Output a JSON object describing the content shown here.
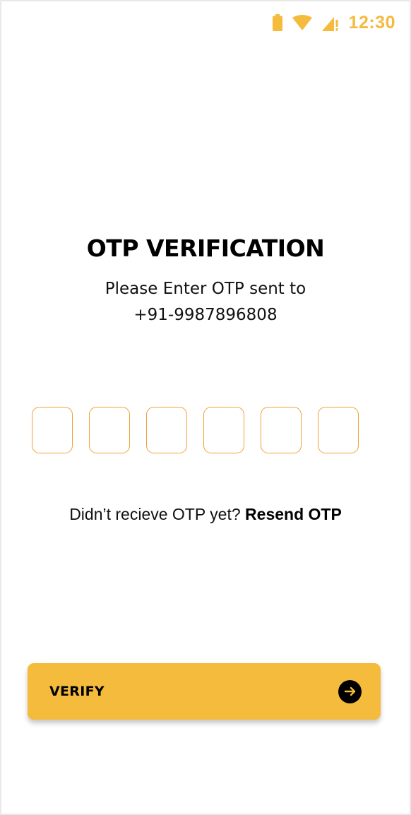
{
  "status_bar": {
    "time": "12:30",
    "icons": [
      "battery-icon",
      "wifi-icon",
      "cell-signal-icon"
    ],
    "accent_color": "#f4bb3d"
  },
  "header": {
    "title": "OTP VERIFICATION",
    "subtitle_line1": "Please Enter OTP sent to",
    "subtitle_line2": "+91-9987896808"
  },
  "otp": {
    "digit_count": 6,
    "values": [
      "",
      "",
      "",
      "",
      "",
      ""
    ],
    "border_color": "#f0a238"
  },
  "resend": {
    "prompt": "Didn’t recieve OTP yet?",
    "link_label": "Resend OTP"
  },
  "verify_button": {
    "label": "VERIFY",
    "icon": "arrow-right-circle-icon",
    "background": "#f4bb3d"
  }
}
